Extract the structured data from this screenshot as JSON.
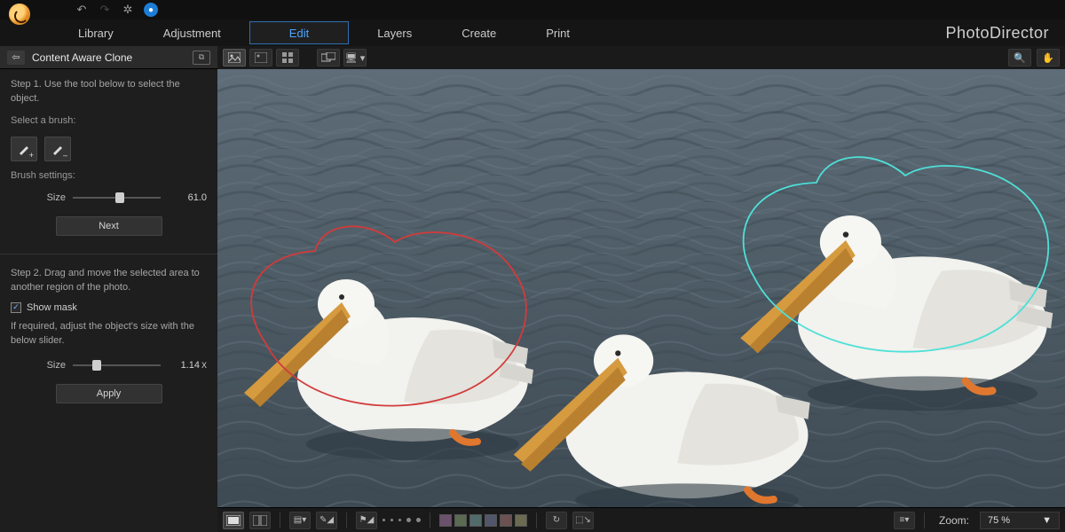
{
  "app": {
    "brand": "PhotoDirector"
  },
  "menu": {
    "items": [
      "Library",
      "Adjustment",
      "Edit",
      "Layers",
      "Create",
      "Print"
    ],
    "active_index": 2
  },
  "panel": {
    "title": "Content Aware Clone",
    "step1_text": "Step 1. Use the tool below to select the object.",
    "select_brush_label": "Select a brush:",
    "brush_settings_label": "Brush settings:",
    "size_label": "Size",
    "size_value": "61.0",
    "next_label": "Next",
    "step2_text": "Step 2. Drag and move the selected area to another region of the photo.",
    "show_mask_label": "Show mask",
    "show_mask_checked": true,
    "step2_hint": "If required, adjust the object's size with the below slider.",
    "size2_label": "Size",
    "size2_value": "1.14",
    "size2_suffix": "X",
    "apply_label": "Apply"
  },
  "toolbar": {
    "right_icons": [
      "magnify-icon",
      "hand-icon"
    ]
  },
  "status": {
    "swatches": [
      "#6b516b",
      "#5a6b51",
      "#516b6b",
      "#51566b",
      "#6b5151",
      "#6b6b51"
    ],
    "zoom_label": "Zoom:",
    "zoom_value": "75 %"
  },
  "image": {
    "description": "Three white pelicans swimming on gray water. The left pelican is outlined with an irregular red selection. The right pelican (cloned copy) is outlined with a cyan selection."
  }
}
